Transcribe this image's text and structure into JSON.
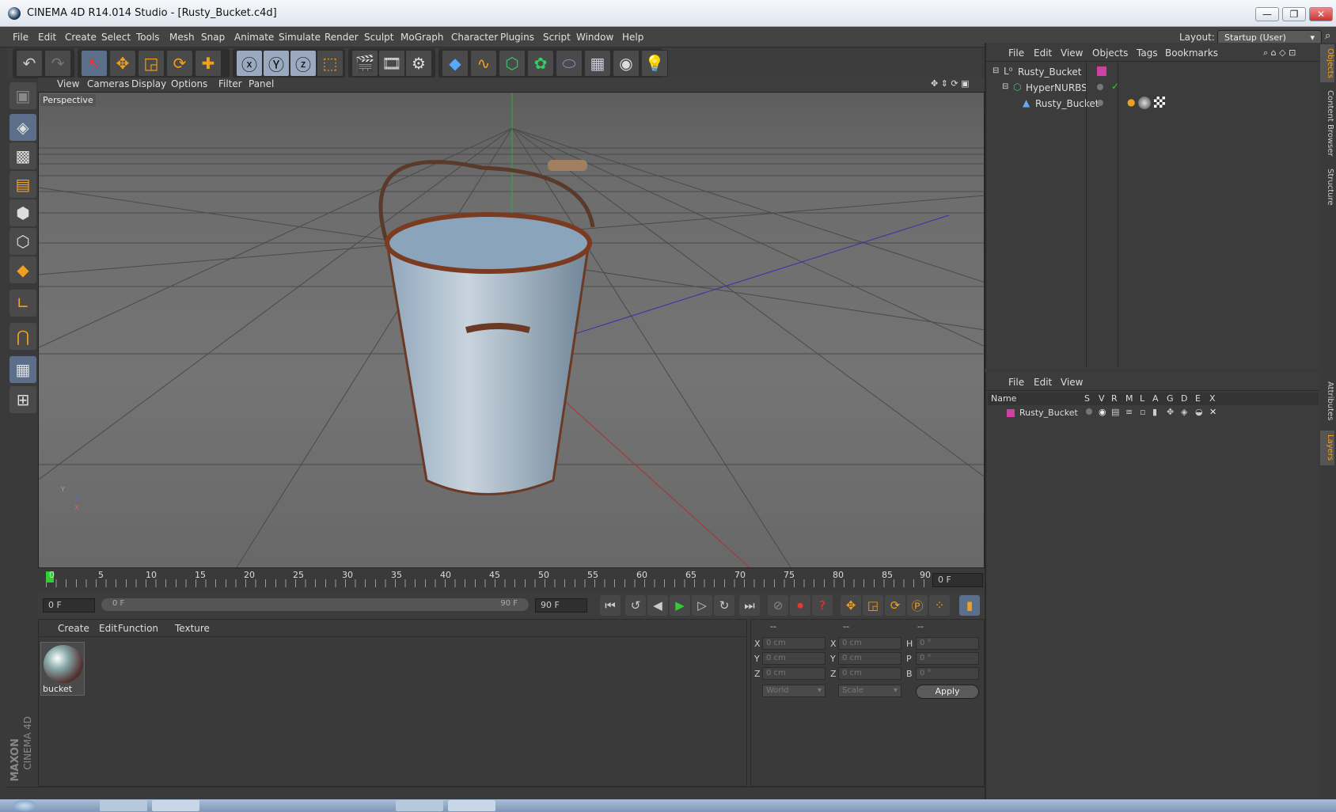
{
  "window": {
    "title": "CINEMA 4D R14.014 Studio - [Rusty_Bucket.c4d]"
  },
  "menubar": {
    "items": [
      "File",
      "Edit",
      "Create",
      "Select",
      "Tools",
      "Mesh",
      "Snap",
      "Animate",
      "Simulate",
      "Render",
      "Sculpt",
      "MoGraph",
      "Character",
      "Plugins",
      "Script",
      "Window",
      "Help"
    ],
    "layout_label": "Layout:",
    "layout_value": "Startup (User)"
  },
  "viewport": {
    "menu": [
      "View",
      "Cameras",
      "Display",
      "Options",
      "Filter",
      "Panel"
    ],
    "label": "Perspective",
    "axis_x": "X",
    "axis_y": "Y",
    "axis_z": "Z"
  },
  "timeline": {
    "ticks": [
      "0",
      "5",
      "10",
      "15",
      "20",
      "25",
      "30",
      "35",
      "40",
      "45",
      "50",
      "55",
      "60",
      "65",
      "70",
      "75",
      "80",
      "85",
      "90"
    ],
    "current_frame": "0 F",
    "start_field": "0 F",
    "range_start": "0 F",
    "range_end": "90 F",
    "end_field": "90 F"
  },
  "material_panel": {
    "menu": [
      "Create",
      "Edit",
      "Function",
      "Texture"
    ],
    "materials": [
      {
        "name": "bucket"
      }
    ]
  },
  "coord_panel": {
    "headers": [
      "--",
      "--",
      "--"
    ],
    "rows": [
      {
        "a": "X",
        "av": "0 cm",
        "b": "X",
        "bv": "0 cm",
        "c": "H",
        "cv": "0 °"
      },
      {
        "a": "Y",
        "av": "0 cm",
        "b": "Y",
        "bv": "0 cm",
        "c": "P",
        "cv": "0 °"
      },
      {
        "a": "Z",
        "av": "0 cm",
        "b": "Z",
        "bv": "0 cm",
        "c": "B",
        "cv": "0 °"
      }
    ],
    "mode1": "World",
    "mode2": "Scale",
    "apply": "Apply"
  },
  "object_manager": {
    "menu": [
      "File",
      "Edit",
      "View",
      "Objects",
      "Tags",
      "Bookmarks"
    ],
    "objects": [
      {
        "name": "Rusty_Bucket",
        "indent": 0
      },
      {
        "name": "HyperNURBS",
        "indent": 1
      },
      {
        "name": "Rusty_Bucket",
        "indent": 2
      }
    ]
  },
  "layer_manager": {
    "menu": [
      "File",
      "Edit",
      "View"
    ],
    "columns": [
      "Name",
      "S",
      "V",
      "R",
      "M",
      "L",
      "A",
      "G",
      "D",
      "E",
      "X"
    ],
    "layers": [
      {
        "name": "Rusty_Bucket",
        "color": "#d040a0"
      }
    ]
  },
  "side_tabs": [
    "Objects",
    "Content Browser",
    "Structure",
    "Attributes",
    "Layers"
  ],
  "branding": {
    "maxon": "MAXON",
    "product": "CINEMA 4D"
  },
  "colors": {
    "accent": "#f0a020",
    "selected": "#5b6e8a",
    "layer": "#d040a0",
    "green": "#39c839"
  }
}
